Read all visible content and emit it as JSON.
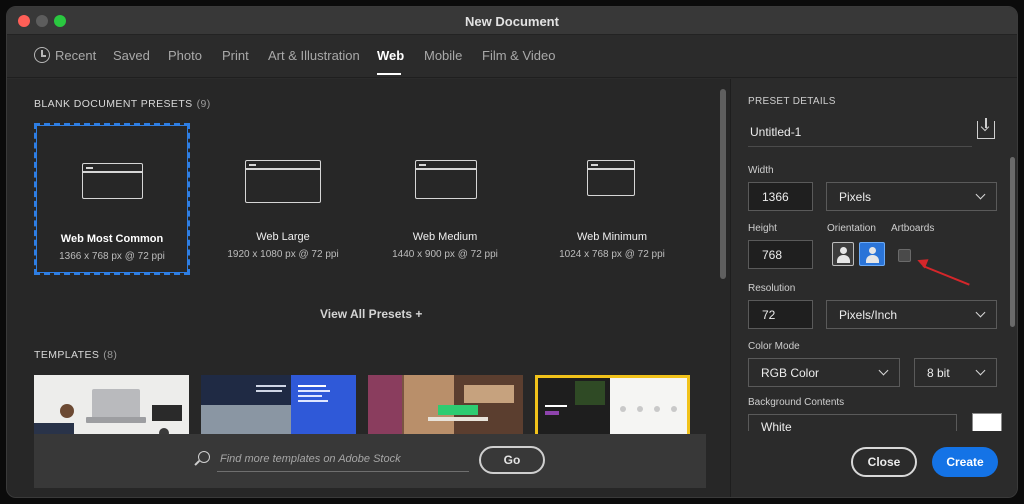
{
  "window": {
    "title": "New Document"
  },
  "tabs": [
    {
      "label": "Recent"
    },
    {
      "label": "Saved"
    },
    {
      "label": "Photo"
    },
    {
      "label": "Print"
    },
    {
      "label": "Art & Illustration"
    },
    {
      "label": "Web"
    },
    {
      "label": "Mobile"
    },
    {
      "label": "Film & Video"
    }
  ],
  "active_tab": "Web",
  "blank_presets": {
    "title": "BLANK DOCUMENT PRESETS",
    "count": "(9)",
    "items": [
      {
        "name": "Web Most Common",
        "size": "1366 x 768 px @ 72 ppi",
        "selected": true
      },
      {
        "name": "Web Large",
        "size": "1920 x 1080 px @ 72 ppi",
        "selected": false
      },
      {
        "name": "Web Medium",
        "size": "1440 x 900 px @ 72 ppi",
        "selected": false
      },
      {
        "name": "Web Minimum",
        "size": "1024 x 768 px @ 72 ppi",
        "selected": false
      }
    ],
    "view_all": "View All Presets +"
  },
  "templates": {
    "title": "TEMPLATES",
    "count": "(8)"
  },
  "search": {
    "placeholder": "Find more templates on Adobe Stock",
    "go_label": "Go"
  },
  "preset_details": {
    "title": "PRESET DETAILS",
    "document_name": "Untitled-1",
    "width_label": "Width",
    "width_value": "1366",
    "width_unit": "Pixels",
    "height_label": "Height",
    "height_value": "768",
    "orientation_label": "Orientation",
    "artboards_label": "Artboards",
    "artboards_checked": false,
    "resolution_label": "Resolution",
    "resolution_value": "72",
    "resolution_unit": "Pixels/Inch",
    "color_mode_label": "Color Mode",
    "color_mode_value": "RGB Color",
    "bit_depth_value": "8 bit",
    "background_label": "Background Contents",
    "background_value": "White",
    "background_color": "#ffffff"
  },
  "actions": {
    "close_label": "Close",
    "create_label": "Create"
  },
  "colors": {
    "accent": "#1473e6",
    "selection": "#2e7ee3",
    "annotation_arrow": "#d5262a"
  }
}
